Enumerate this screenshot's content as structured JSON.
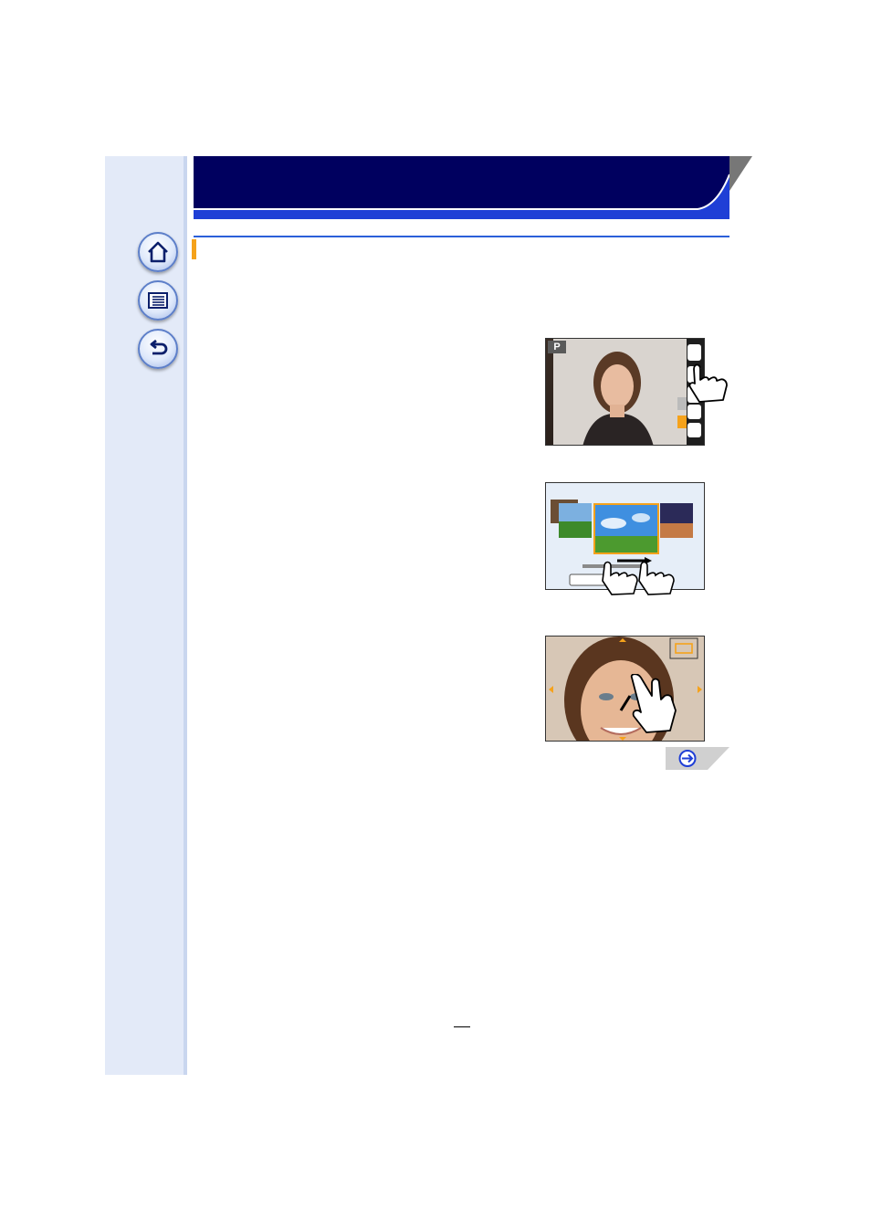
{
  "colors": {
    "sidebar_bg": "#e3eaf8",
    "header_navy": "#00005f",
    "header_accent_blue": "#1f3fd6",
    "section_rule": "#2b5fd9",
    "section_marker": "#f5a21b",
    "highlight_orange": "#f5a21b"
  },
  "sidebar": {
    "buttons": [
      {
        "name": "home-button",
        "icon": "home-icon"
      },
      {
        "name": "contents-button",
        "icon": "list-icon"
      },
      {
        "name": "back-button",
        "icon": "return-arrow-icon"
      }
    ]
  },
  "figures": {
    "touch_icon_screen": {
      "mode_label": "P",
      "icon": "touch-hand-icon"
    },
    "swipe_selection_screen": {
      "icon": "swipe-hand-icon"
    },
    "pinch_zoom_screen": {
      "icon": "pinch-hand-icon"
    }
  },
  "next_page": {
    "icon": "arrow-right-circle-icon"
  },
  "footer": {
    "page_number": ""
  }
}
